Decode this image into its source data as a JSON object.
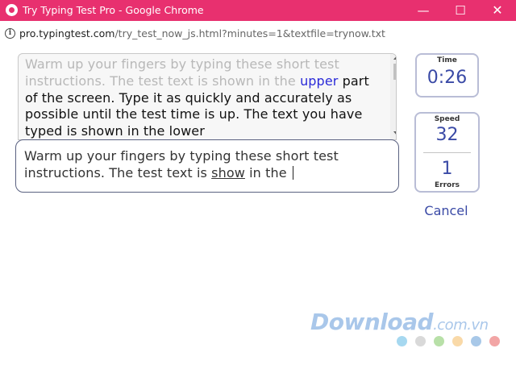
{
  "window": {
    "title": "Try Typing Test Pro - Google Chrome",
    "controls": {
      "minimize": "—",
      "maximize": "☐",
      "close": "✕"
    }
  },
  "address": {
    "host": "pro.typingtest.com",
    "path": "/try_test_now_js.html?minutes=1&textfile=trynow.txt"
  },
  "test_text": {
    "typed": "Warm up your fingers by typing these short test instructions. The test text is shown in the ",
    "current_word": "upper",
    "remaining": " part of the screen. Type it as quickly and accurately as possible until the test time is up. The text you have typed is shown in the lower"
  },
  "typing_input": {
    "before": "Warm up your fingers by typing these short test instructions. The test text is ",
    "error_word": "show",
    "after": " in the "
  },
  "stats": {
    "time_label": "Time",
    "time_value": "0:26",
    "speed_label": "Speed",
    "speed_value": "32",
    "errors_value": "1",
    "errors_label": "Errors"
  },
  "cancel_label": "Cancel",
  "watermark": {
    "brand": "Download",
    "tld": ".com.vn"
  },
  "watermark_dot_colors": [
    "#a6d8f0",
    "#d9d9d9",
    "#b8e0a8",
    "#f9d9a8",
    "#a8c8e8",
    "#f2a5a5"
  ]
}
